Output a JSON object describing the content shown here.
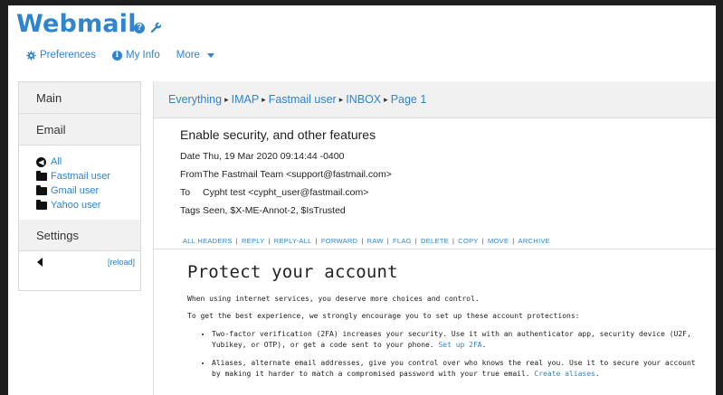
{
  "app": {
    "brand": "Webmail"
  },
  "topnav": {
    "preferences": "Preferences",
    "my_info": "My Info",
    "more": "More"
  },
  "sidebar": {
    "main": "Main",
    "email": "Email",
    "folders": [
      "All",
      "Fastmail user",
      "Gmail user",
      "Yahoo user"
    ],
    "settings": "Settings",
    "reload": "[reload]"
  },
  "breadcrumb": {
    "everything": "Everything",
    "imap": "IMAP",
    "account": "Fastmail user",
    "inbox": "INBOX",
    "page": "Page 1"
  },
  "message": {
    "subject": "Enable security, and other features",
    "headers": [
      {
        "key": "Date",
        "value": "Thu, 19 Mar 2020 09:14:44 -0400"
      },
      {
        "key": "From",
        "value": "The Fastmail Team <support@fastmail.com>"
      },
      {
        "key": "To",
        "value": "Cypht test <cypht_user@fastmail.com>"
      },
      {
        "key": "Tags",
        "value": "Seen, $X-ME-Annot-2, $IsTrusted"
      }
    ],
    "actions": [
      "ALL HEADERS",
      "REPLY",
      "REPLY-ALL",
      "FORWARD",
      "RAW",
      "FLAG",
      "DELETE",
      "COPY",
      "MOVE",
      "ARCHIVE"
    ],
    "body": {
      "heading": "Protect your account",
      "p1": "When using internet services, you deserve more choices and control.",
      "p2": "To get the best experience, we strongly encourage you to set up these account protections:",
      "li1_text": "Two-factor verification (2FA) increases your security. Use it with an authenticator app, security device (U2F, Yubikey, or OTP), or get a code sent to your phone. ",
      "li1_link": "Set up 2FA",
      "li1_end": ".",
      "li2_text": "Aliases, alternate email addresses, give you control over who knows the real you. Use it to secure your account by making it harder to match a compromised password with your true email. ",
      "li2_link": "Create aliases",
      "li2_end": "."
    }
  }
}
